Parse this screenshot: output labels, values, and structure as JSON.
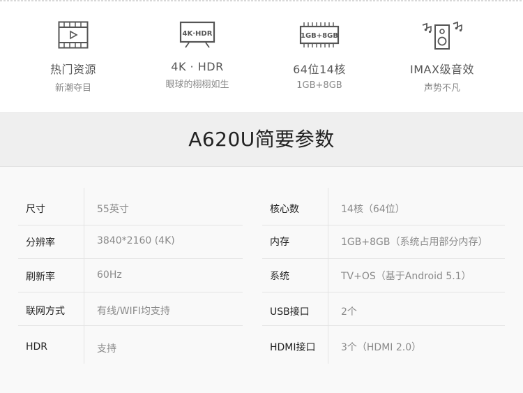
{
  "features": [
    {
      "title": "热门资源",
      "subtitle": "新潮夺目",
      "icon": "film-icon"
    },
    {
      "title": "4K · HDR",
      "subtitle": "眼球的栩栩如生",
      "icon": "tv-4k-hdr-icon",
      "badge": "4K·HDR"
    },
    {
      "title": "64位14核",
      "subtitle": "1GB+8GB",
      "icon": "chip-icon",
      "badge": "1GB+8GB"
    },
    {
      "title": "IMAX级音效",
      "subtitle": "声势不凡",
      "icon": "speaker-icon"
    }
  ],
  "specs_title": "A620U简要参数",
  "specs_left": [
    {
      "label": "尺寸",
      "value": "55英寸"
    },
    {
      "label": "分辨率",
      "value": "3840*2160 (4K)"
    },
    {
      "label": "刷新率",
      "value": "60Hz"
    },
    {
      "label": "联网方式",
      "value": "有线/WIFI均支持"
    },
    {
      "label": "HDR",
      "value": "支持"
    }
  ],
  "specs_right": [
    {
      "label": "核心数",
      "value": "14核（64位）"
    },
    {
      "label": "内存",
      "value": "1GB+8GB（系统占用部分内存）"
    },
    {
      "label": "系统",
      "value": "TV+OS（基于Android 5.1）"
    },
    {
      "label": "USB接口",
      "value": "2个"
    },
    {
      "label": "HDMI接口",
      "value": "3个（HDMI 2.0）"
    }
  ]
}
